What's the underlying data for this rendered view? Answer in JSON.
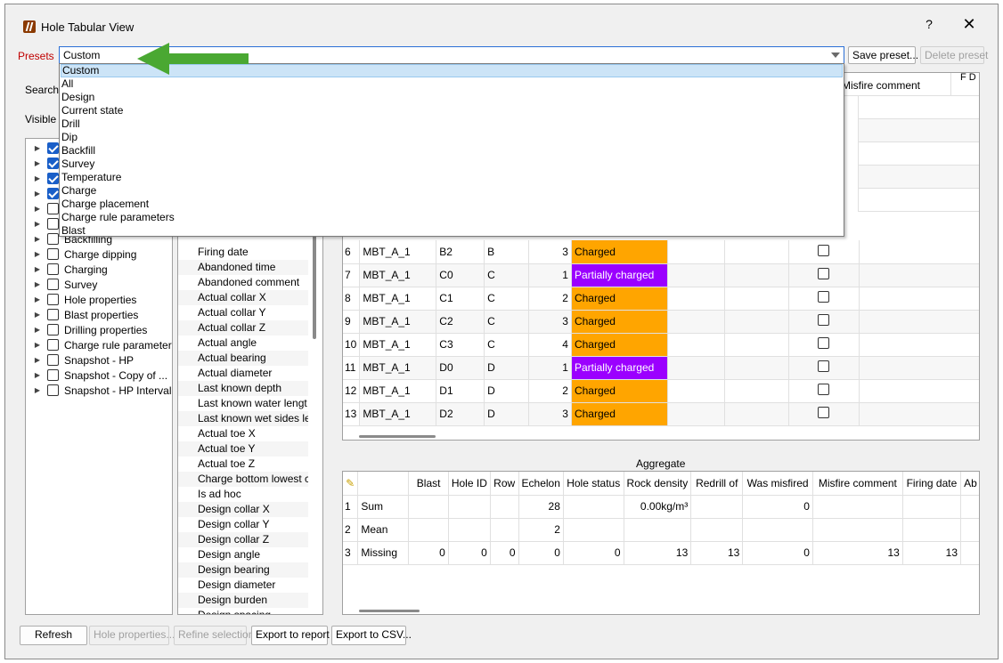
{
  "window": {
    "title": "Hole Tabular View",
    "help": "?",
    "close": "✕"
  },
  "presets": {
    "label": "Presets",
    "selected": "Custom",
    "save_label": "Save preset...",
    "delete_label": "Delete preset",
    "options": [
      "Custom",
      "All",
      "Design",
      "Current state",
      "Drill",
      "Dip",
      "Backfill",
      "Survey",
      "Temperature",
      "Charge",
      "Charge placement",
      "Charge rule parameters",
      "Blast"
    ]
  },
  "left": {
    "search_label": "Search",
    "visible_label": "Visible c"
  },
  "tree": [
    {
      "label": "",
      "checked": true
    },
    {
      "label": "",
      "checked": true
    },
    {
      "label": "",
      "checked": true
    },
    {
      "label": "",
      "checked": true
    },
    {
      "label": "",
      "checked": false
    },
    {
      "label": "",
      "checked": false
    },
    {
      "label": "Backfilling",
      "checked": false
    },
    {
      "label": "Charge dipping",
      "checked": false
    },
    {
      "label": "Charging",
      "checked": false
    },
    {
      "label": "Survey",
      "checked": false
    },
    {
      "label": "Hole properties",
      "checked": false
    },
    {
      "label": "Blast properties",
      "checked": false
    },
    {
      "label": "Drilling properties",
      "checked": false
    },
    {
      "label": "Charge rule parameter",
      "checked": false
    },
    {
      "label": "Snapshot - HP",
      "checked": false
    },
    {
      "label": "Snapshot - Copy of ...",
      "checked": false
    },
    {
      "label": "Snapshot - HP Interval",
      "checked": false
    }
  ],
  "columns_list": [
    "Firing date",
    "Abandoned time",
    "Abandoned comment",
    "Actual collar X",
    "Actual collar Y",
    "Actual collar Z",
    "Actual angle",
    "Actual bearing",
    "Actual diameter",
    "Last known depth",
    "Last known water lengt",
    "Last known wet sides le",
    "Actual toe X",
    "Actual toe Y",
    "Actual toe Z",
    "Charge bottom lowest c",
    "Is ad hoc",
    "Design collar X",
    "Design collar Y",
    "Design collar Z",
    "Design angle",
    "Design bearing",
    "Design diameter",
    "Design burden",
    "Design spacing"
  ],
  "grid": {
    "header_visible": [
      "ed",
      "Misfire comment",
      "F D"
    ],
    "rows": [
      {
        "n": "6",
        "blast": "MBT_A_1",
        "hole": "B2",
        "row": "B",
        "ech": "3",
        "status": "Charged",
        "kind": "charged"
      },
      {
        "n": "7",
        "blast": "MBT_A_1",
        "hole": "C0",
        "row": "C",
        "ech": "1",
        "status": "Partially charged",
        "kind": "partial"
      },
      {
        "n": "8",
        "blast": "MBT_A_1",
        "hole": "C1",
        "row": "C",
        "ech": "2",
        "status": "Charged",
        "kind": "charged"
      },
      {
        "n": "9",
        "blast": "MBT_A_1",
        "hole": "C2",
        "row": "C",
        "ech": "3",
        "status": "Charged",
        "kind": "charged"
      },
      {
        "n": "10",
        "blast": "MBT_A_1",
        "hole": "C3",
        "row": "C",
        "ech": "4",
        "status": "Charged",
        "kind": "charged"
      },
      {
        "n": "11",
        "blast": "MBT_A_1",
        "hole": "D0",
        "row": "D",
        "ech": "1",
        "status": "Partially charged",
        "kind": "partial"
      },
      {
        "n": "12",
        "blast": "MBT_A_1",
        "hole": "D1",
        "row": "D",
        "ech": "2",
        "status": "Charged",
        "kind": "charged"
      },
      {
        "n": "13",
        "blast": "MBT_A_1",
        "hole": "D2",
        "row": "D",
        "ech": "3",
        "status": "Charged",
        "kind": "charged"
      }
    ]
  },
  "aggregate": {
    "title": "Aggregate",
    "corner_icon": "edit-icon",
    "headers": [
      "Blast",
      "Hole ID",
      "Row",
      "Echelon",
      "Hole status",
      "Rock density",
      "Redrill of",
      "Was misfired",
      "Misfire comment",
      "Firing date",
      "Ab"
    ],
    "rows": [
      {
        "n": "1",
        "label": "Sum",
        "cells": [
          "",
          "",
          "",
          "28",
          "",
          "0.00kg/m³",
          "",
          "0",
          "",
          "",
          ""
        ]
      },
      {
        "n": "2",
        "label": "Mean",
        "cells": [
          "",
          "",
          "",
          "2",
          "",
          "",
          "",
          "",
          "",
          "",
          ""
        ]
      },
      {
        "n": "3",
        "label": "Missing",
        "cells": [
          "0",
          "0",
          "0",
          "0",
          "0",
          "13",
          "13",
          "0",
          "13",
          "13",
          ""
        ]
      }
    ]
  },
  "bottom": {
    "refresh": "Refresh",
    "hole_properties": "Hole properties...",
    "refine": "Refine selection",
    "export_report": "Export to report",
    "export_csv": "Export to CSV..."
  },
  "colors": {
    "charged": "#ffa500",
    "partial": "#9b00ff",
    "accent": "#2b6fd6",
    "presets_label": "#c00000",
    "annotation_arrow": "#4aa832"
  }
}
